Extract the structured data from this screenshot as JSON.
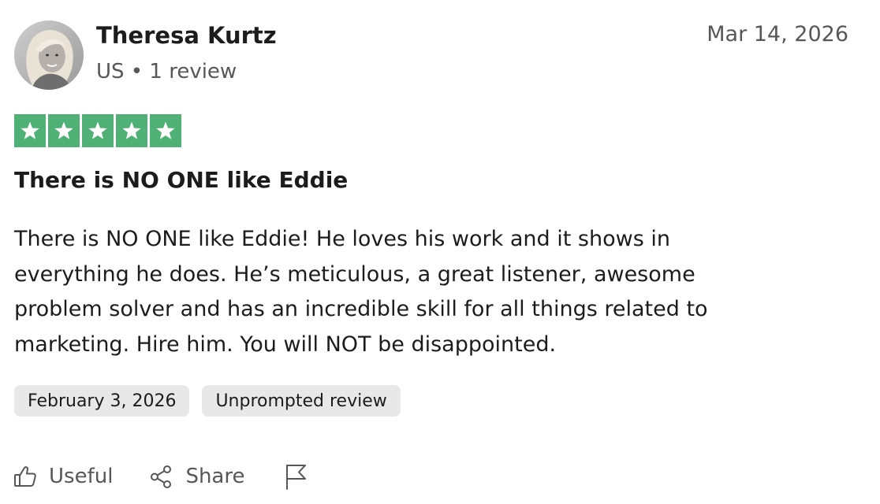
{
  "reviewer": {
    "name": "Theresa Kurtz",
    "meta": "US • 1 review",
    "avatar_icon": "reviewer-avatar-photo"
  },
  "review": {
    "date": "Mar 14, 2026",
    "rating": 5,
    "star_color": "#4fb176",
    "title": "There is NO ONE like Eddie",
    "body": "There is NO ONE like Eddie! He loves his work and it shows in everything he does. He’s meticulous, a great listener, awesome problem solver and has an incredible skill for all things related to marketing. Hire him. You will NOT be disappointed."
  },
  "tags": {
    "experience_date": "February 3, 2026",
    "source": "Unprompted review"
  },
  "actions": {
    "useful_label": "Useful",
    "useful_icon": "thumbs-up-icon",
    "share_label": "Share",
    "share_icon": "share-icon",
    "report_icon": "flag-icon"
  }
}
